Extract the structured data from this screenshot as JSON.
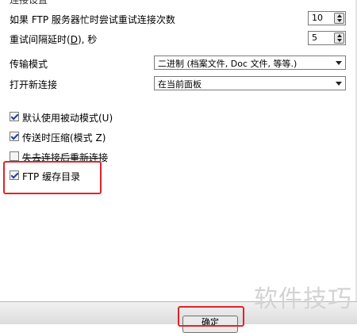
{
  "section_title": "连接设置",
  "retry": {
    "count_label": "如果 FTP 服务器忙时尝试重试连接次数",
    "count_value": "10",
    "delay_label_pre": "重试间隔延时(",
    "delay_hotkey": "D",
    "delay_label_post": "), 秒",
    "delay_value": "5"
  },
  "transfer_mode": {
    "label": "传输模式",
    "value": "二进制 (档案文件, Doc 文件, 等等.)"
  },
  "open_new_connection": {
    "label": "打开新连接",
    "value": "在当前面板"
  },
  "options": [
    {
      "label": "默认使用被动模式(U)",
      "checked": true
    },
    {
      "label": "传送时压缩(模式 Z)",
      "checked": true
    },
    {
      "label": "失去连接后重新连接",
      "checked": false
    },
    {
      "label": "FTP 缓存目录",
      "checked": true
    }
  ],
  "ok_button": "确定",
  "watermark": "软件技巧",
  "highlight_color": "#e0242a"
}
